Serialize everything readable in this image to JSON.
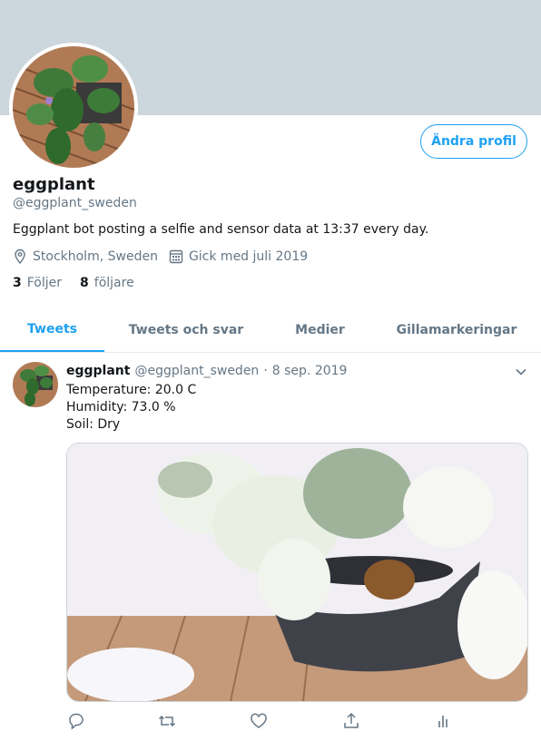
{
  "profile": {
    "name": "eggplant",
    "handle": "@eggplant_sweden",
    "bio": "Eggplant bot posting a selfie and sensor data at 13:37 every day.",
    "location": "Stockholm, Sweden",
    "joined": "Gick med juli 2019",
    "following_count": "3",
    "following_label": "Följer",
    "followers_count": "8",
    "followers_label": "följare",
    "edit_button": "Ändra profil"
  },
  "tabs": [
    {
      "label": "Tweets",
      "active": true
    },
    {
      "label": "Tweets och svar",
      "active": false
    },
    {
      "label": "Medier",
      "active": false
    },
    {
      "label": "Gillamarkeringar",
      "active": false
    }
  ],
  "tweet": {
    "name": "eggplant",
    "handle": "@eggplant_sweden",
    "separator": "·",
    "date": "8 sep. 2019",
    "lines": [
      "Temperature: 20.0 C",
      "Humidity: 73.0 %",
      "Soil: Dry"
    ]
  },
  "icons": {
    "location": "map-pin-icon",
    "joined": "calendar-icon",
    "caret": "chevron-down-icon",
    "reply": "reply-icon",
    "retweet": "retweet-icon",
    "like": "heart-icon",
    "share": "share-icon",
    "analytics": "analytics-icon"
  },
  "colors": {
    "accent": "#1da1f2",
    "banner": "#ccd6dd",
    "secondary_text": "#657786",
    "primary_text": "#14171a"
  }
}
